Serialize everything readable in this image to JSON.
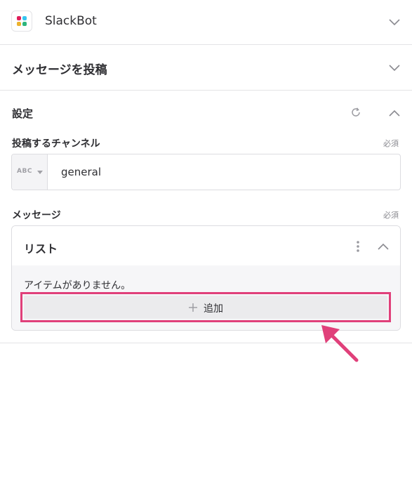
{
  "app": {
    "name": "SlackBot",
    "icon": "slack-logo-icon"
  },
  "action": {
    "title": "メッセージを投稿"
  },
  "settings": {
    "title": "設定",
    "channel": {
      "label": "投稿するチャンネル",
      "required": "必須",
      "type_badge": "ABC",
      "value": "general"
    },
    "message": {
      "label": "メッセージ",
      "required": "必須",
      "list": {
        "title": "リスト",
        "empty_text": "アイテムがありません。",
        "add_label": "追加"
      }
    }
  },
  "colors": {
    "highlight": "#e0407a",
    "arrow": "#e0407a",
    "divider": "#e3e3e6",
    "button_bg": "#ebebed"
  }
}
